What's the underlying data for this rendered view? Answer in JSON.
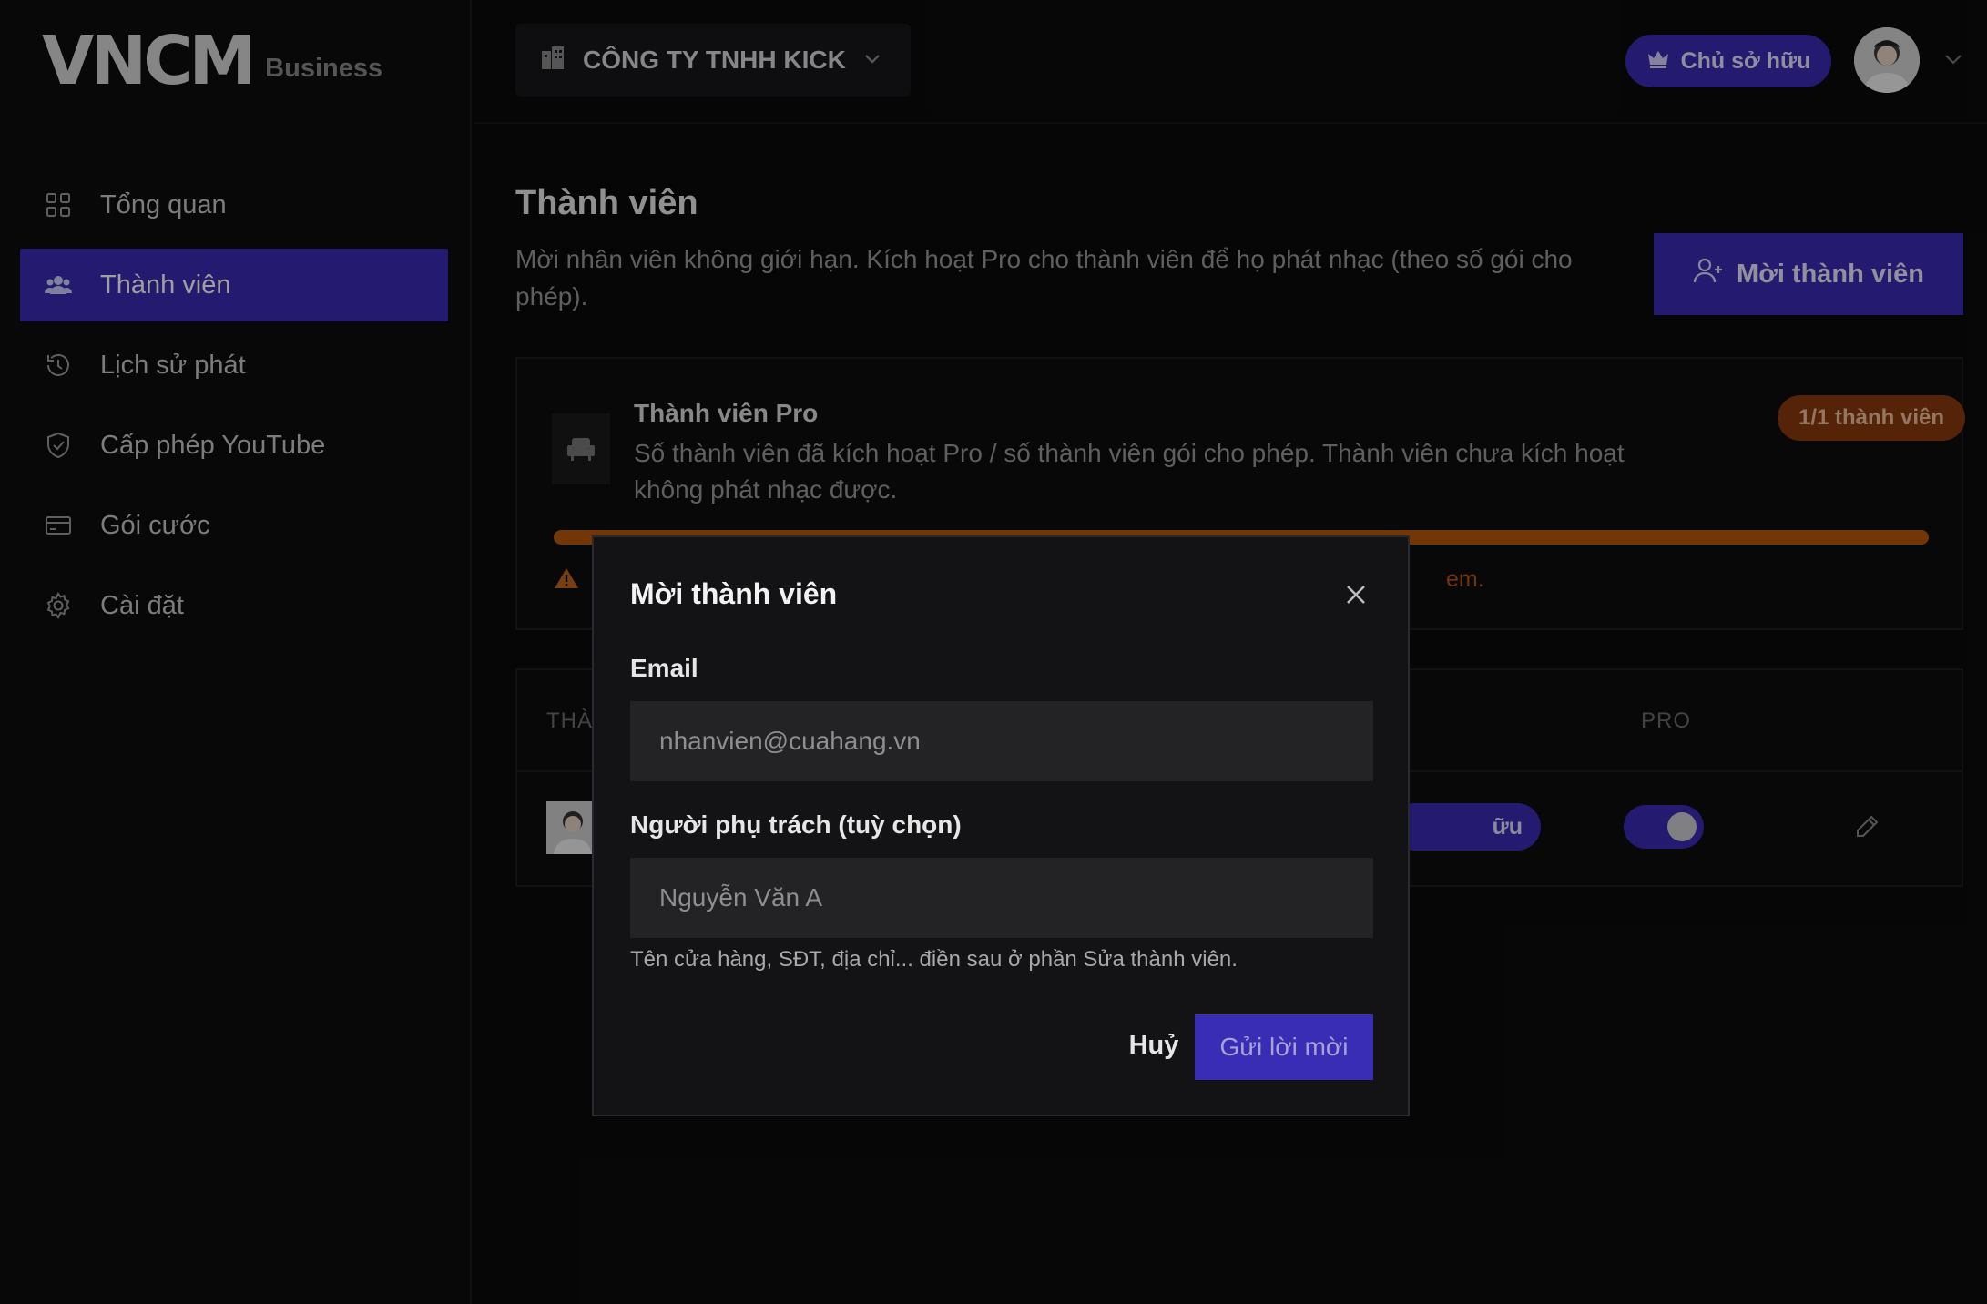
{
  "brand": {
    "logo": "VNCM",
    "sub": "Business"
  },
  "sidebar": {
    "items": [
      {
        "label": "Tổng quan",
        "icon": "grid-icon"
      },
      {
        "label": "Thành viên",
        "icon": "users-icon",
        "active": true
      },
      {
        "label": "Lịch sử phát",
        "icon": "history-icon"
      },
      {
        "label": "Cấp phép YouTube",
        "icon": "shield-check-icon"
      },
      {
        "label": "Gói cước",
        "icon": "card-icon"
      },
      {
        "label": "Cài đặt",
        "icon": "gear-icon"
      }
    ]
  },
  "header": {
    "company": "CÔNG TY TNHH KICK",
    "owner_badge": "Chủ sở hữu"
  },
  "page": {
    "title": "Thành viên",
    "description": "Mời nhân viên không giới hạn. Kích hoạt Pro cho thành viên để họ phát nhạc (theo số gói cho phép).",
    "invite_button": "Mời thành viên"
  },
  "pro_card": {
    "title": "Thành viên Pro",
    "description": "Số thành viên đã kích hoạt Pro / số thành viên gói cho phép. Thành viên chưa kích hoạt không phát nhạc được.",
    "badge": "1/1 thành viên",
    "progress": 1.0,
    "warning_visible": "em."
  },
  "table": {
    "headers": {
      "member": "THÀ",
      "pro": "PRO"
    },
    "rows": [
      {
        "role": "ữu",
        "pro_enabled": true
      }
    ]
  },
  "modal": {
    "title": "Mời thành viên",
    "email_label": "Email",
    "email_placeholder": "nhanvien@cuahang.vn",
    "manager_label": "Người phụ trách (tuỳ chọn)",
    "manager_placeholder": "Nguyễn Văn A",
    "hint": "Tên cửa hàng, SĐT, địa chỉ... điền sau ở phần Sửa thành viên.",
    "cancel": "Huỷ",
    "submit": "Gửi lời mời"
  },
  "colors": {
    "accent": "#3a2db5",
    "warning": "#b85a10",
    "background": "#0b0b0c"
  }
}
